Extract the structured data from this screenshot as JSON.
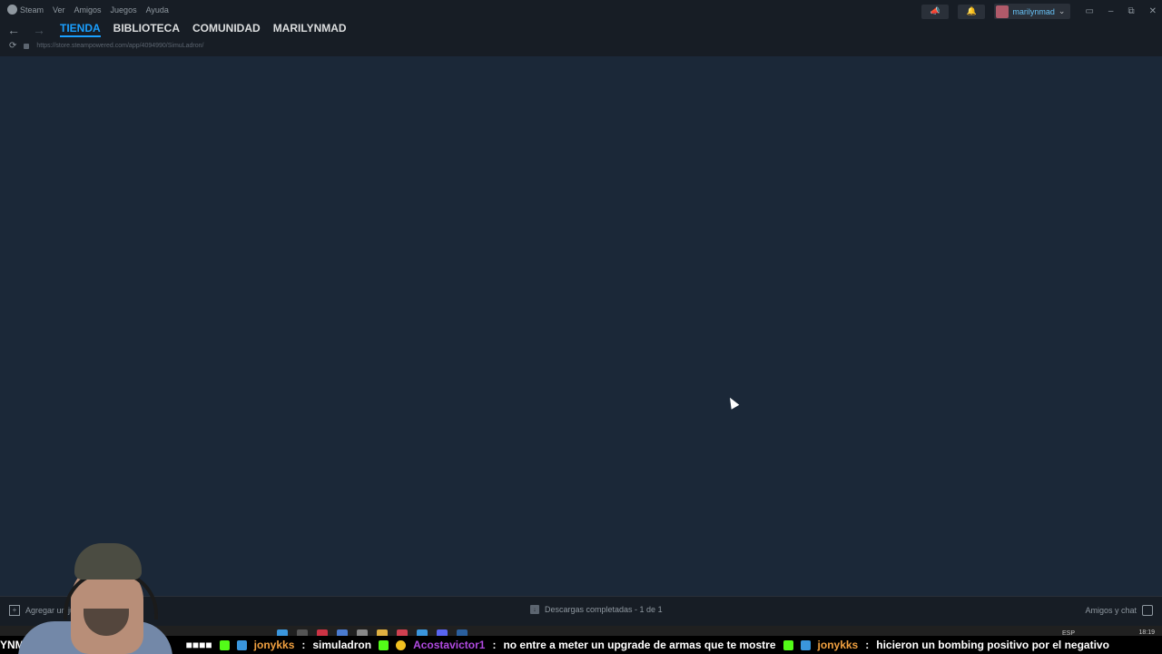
{
  "menu": {
    "items": [
      "Steam",
      "Ver",
      "Amigos",
      "Juegos",
      "Ayuda"
    ]
  },
  "nav": {
    "back_icon": "arrow-left-icon",
    "forward_icon": "arrow-right-icon",
    "tabs": [
      "TIENDA",
      "BIBLIOTECA",
      "COMUNIDAD",
      "MARILYNMAD"
    ],
    "active_tab": "TIENDA"
  },
  "url": "https://store.steampowered.com/app/4094990/SimuLadron/",
  "account": {
    "username": "marilynmad"
  },
  "bottom": {
    "add_game": "Agregar un ju",
    "downloads": "Descargas completadas - 1 de 1",
    "friends": "Amigos y chat"
  },
  "taskbar": {
    "lang": "ESP",
    "time": "18:19"
  },
  "ticker": {
    "lead": "YNM",
    "blocks": "■■■■",
    "msg1_user": "jonykks",
    "msg1_text": "simuladron",
    "msg2_user": "Acostavictor1",
    "msg2_text": "no entre a meter un upgrade de armas que te mostre",
    "msg3_user": "jonykks",
    "msg3_text": "hicieron un bombing positivo  por el negativo"
  },
  "colors": {
    "accent": "#1a9fff",
    "background": "#1b2838",
    "titlebar": "#171d25"
  }
}
